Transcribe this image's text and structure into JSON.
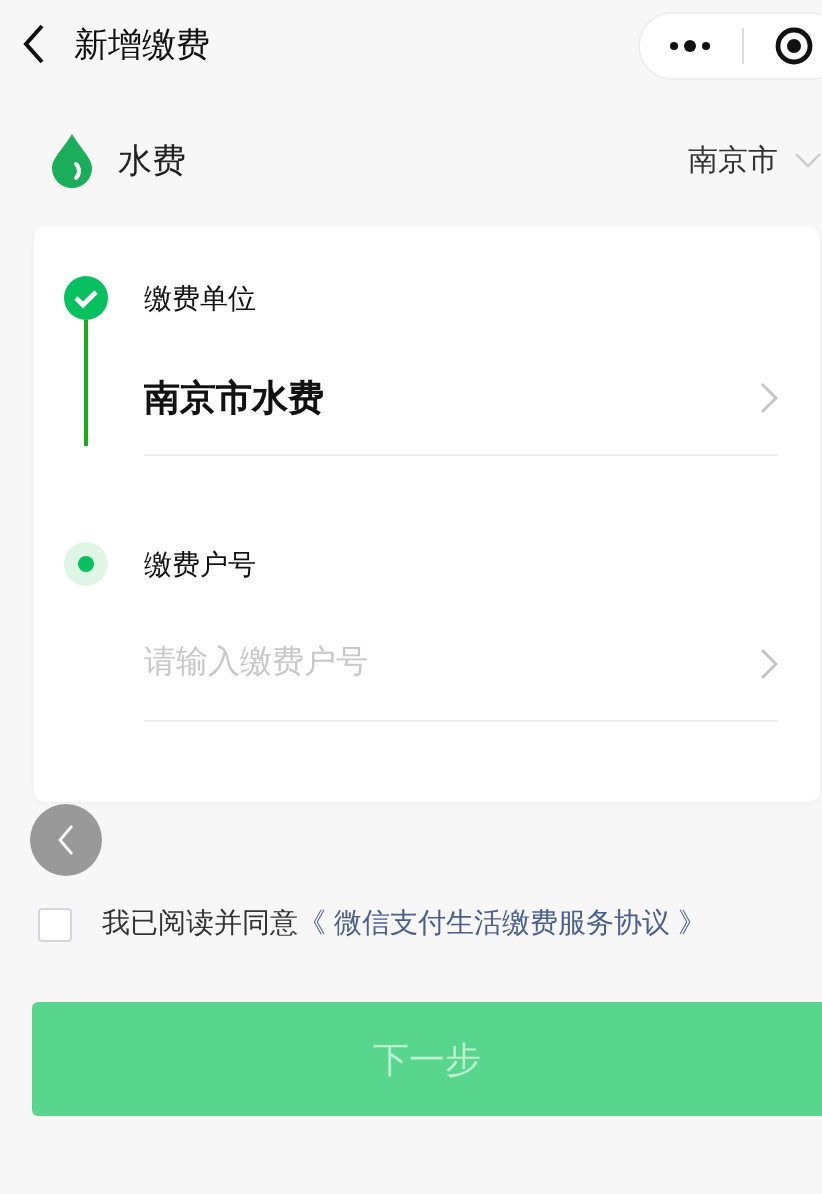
{
  "header": {
    "title": "新增缴费"
  },
  "bill": {
    "name": "水费",
    "city": "南京市"
  },
  "steps": [
    {
      "label": "缴费单位",
      "done": true,
      "kind": "select",
      "value": "南京市水费"
    },
    {
      "label": "缴费户号",
      "done": false,
      "kind": "input",
      "placeholder": "请输入缴费户号"
    }
  ],
  "agreement": {
    "checked": false,
    "text": "我已阅读并同意",
    "link": "《 微信支付生活缴费服务协议 》"
  },
  "next_button": {
    "label": "下一步",
    "disabled": true
  }
}
